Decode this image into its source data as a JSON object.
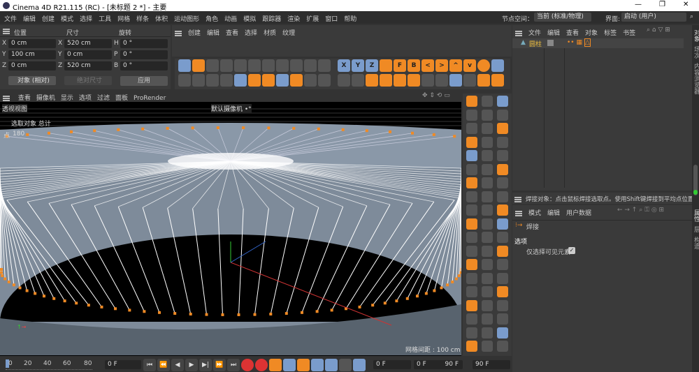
{
  "window": {
    "title": "Cinema 4D R21.115 (RC) - [未标题 2 *] - 主要",
    "minimize": "—",
    "restore": "❐",
    "close": "✕"
  },
  "menu": [
    "文件",
    "编辑",
    "创建",
    "模式",
    "选择",
    "工具",
    "网格",
    "样条",
    "体积",
    "运动图形",
    "角色",
    "动画",
    "模拟",
    "跟踪器",
    "渲染",
    "扩展",
    "窗口",
    "帮助"
  ],
  "nodespace": {
    "label": "节点空间：",
    "value": "当前 (标准/物理)"
  },
  "layout": {
    "label": "界面:",
    "value": "启动 (用户)"
  },
  "coords": {
    "headers": [
      "位置",
      "尺寸",
      "旋转"
    ],
    "rows": [
      {
        "a": "X",
        "pos": "0 cm",
        "b": "X",
        "size": "520 cm",
        "c": "H",
        "rot": "0 °"
      },
      {
        "a": "Y",
        "pos": "100 cm",
        "b": "Y",
        "size": "0 cm",
        "c": "P",
        "rot": "0 °"
      },
      {
        "a": "Z",
        "pos": "0 cm",
        "b": "Z",
        "size": "520 cm",
        "c": "B",
        "rot": "0 °"
      }
    ],
    "mode": "对象 (相对)",
    "sizemode": "绝对尺寸",
    "apply": "应用"
  },
  "material_menu": [
    "创建",
    "编辑",
    "查看",
    "选择",
    "材质",
    "纹理"
  ],
  "axis_buttons": [
    "X",
    "Y",
    "Z"
  ],
  "view_buttons": [
    "F",
    "B",
    "<",
    ">",
    "^",
    "v"
  ],
  "viewport": {
    "menu": [
      "查看",
      "摄像机",
      "显示",
      "选项",
      "过滤",
      "面板",
      "ProRender"
    ],
    "name": "透视视图",
    "camera": "默认摄像机 •°",
    "stats_title": "选取对象 总计",
    "stats_label": "点",
    "stats_value": "180",
    "grid": "网格间距 : 100 cm"
  },
  "objects": {
    "menu": [
      "文件",
      "编辑",
      "查看",
      "对象",
      "标签",
      "书签"
    ],
    "item": "圆柱"
  },
  "side_tabs": [
    "对象",
    "场次",
    "内容浏览器"
  ],
  "status": "焊接对象：点击鼠标焊接选取点。使用Shift键焊接到平均点位置，或",
  "attributes": {
    "menu": [
      "模式",
      "编辑",
      "用户数据"
    ],
    "tool": "焊接",
    "section": "选项",
    "option": "仅选择可见元素",
    "option_checked": true
  },
  "attr_tabs": [
    "属性",
    "层",
    "构造"
  ],
  "timeline": {
    "ticks": [
      "0",
      "20",
      "40",
      "60",
      "80"
    ],
    "current": "0 F",
    "frame": "0 F",
    "range_start": "0 F",
    "range_end": "90 F",
    "end": "90 F"
  },
  "colors": {
    "accent": "#f08a24",
    "selected": "#7a9ccc"
  }
}
